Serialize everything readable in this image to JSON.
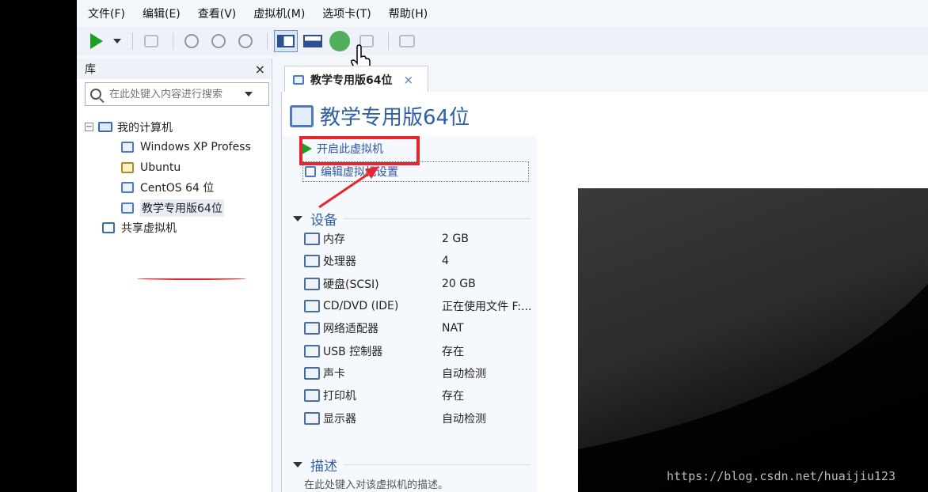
{
  "menu": [
    "文件(F)",
    "编辑(E)",
    "查看(V)",
    "虚拟机(M)",
    "选项卡(T)",
    "帮助(H)"
  ],
  "library": {
    "title": "库",
    "close": "×",
    "search_placeholder": "在此处键入内容进行搜索",
    "tree": {
      "root": "我的计算机",
      "vms": [
        "Windows XP Profess",
        "Ubuntu",
        "CentOS 64 位",
        "教学专用版64位"
      ],
      "shared": "共享虚拟机"
    }
  },
  "tab": {
    "label": "教学专用版64位",
    "close": "×"
  },
  "vm": {
    "title": "教学专用版64位",
    "actions": {
      "start": "开启此虚拟机",
      "edit": "编辑虚拟机设置"
    }
  },
  "devices": {
    "heading": "设备",
    "items": [
      {
        "name": "内存",
        "value": "2 GB",
        "icon": "memory-icon"
      },
      {
        "name": "处理器",
        "value": "4",
        "icon": "cpu-icon"
      },
      {
        "name": "硬盘(SCSI)",
        "value": "20 GB",
        "icon": "hdd-icon"
      },
      {
        "name": "CD/DVD (IDE)",
        "value": "正在使用文件 F:...",
        "icon": "cd-icon"
      },
      {
        "name": "网络适配器",
        "value": "NAT",
        "icon": "network-icon"
      },
      {
        "name": "USB 控制器",
        "value": "存在",
        "icon": "usb-icon"
      },
      {
        "name": "声卡",
        "value": "自动检测",
        "icon": "sound-icon"
      },
      {
        "name": "打印机",
        "value": "存在",
        "icon": "printer-icon"
      },
      {
        "name": "显示器",
        "value": "自动检测",
        "icon": "display-icon"
      }
    ]
  },
  "description": {
    "heading": "描述",
    "text": "在此处键入对该虚拟机的描述。"
  },
  "watermark": "https://blog.csdn.net/huaijiu123",
  "colors": {
    "accent": "#2f5fa6",
    "annotation": "#e5262d",
    "play": "#1aa124"
  }
}
